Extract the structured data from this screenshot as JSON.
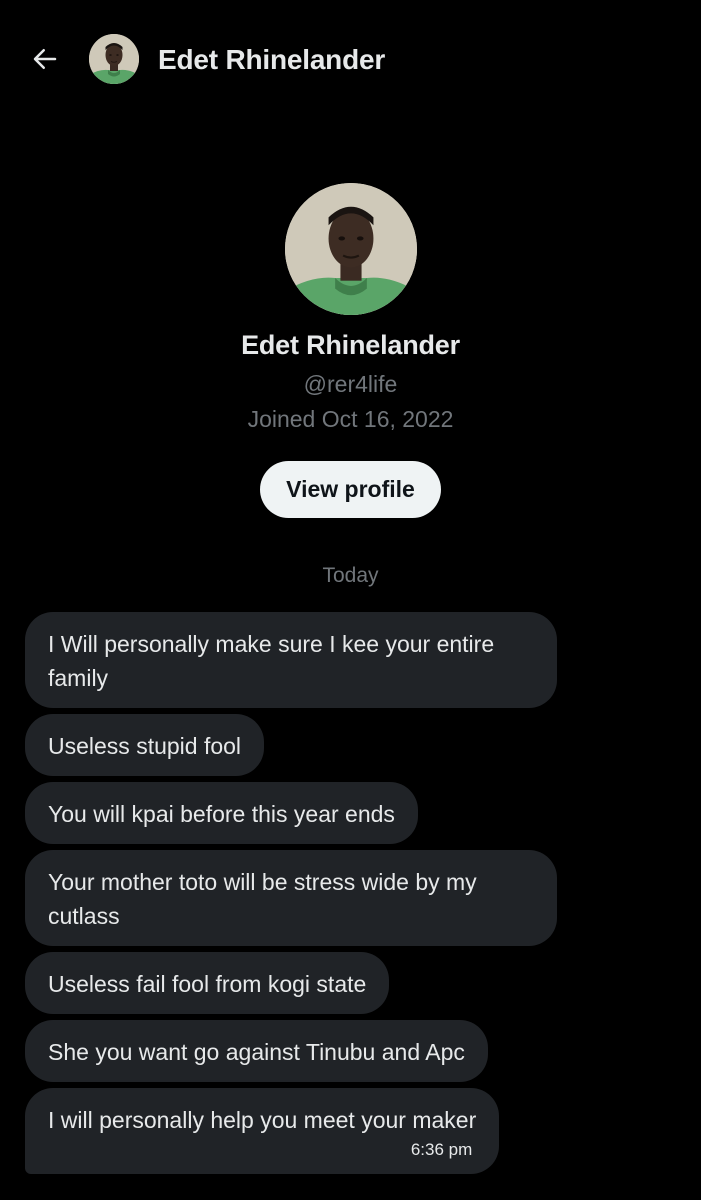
{
  "header": {
    "back_icon": "arrow-left-icon",
    "name": "Edet Rhinelander"
  },
  "profile": {
    "name": "Edet Rhinelander",
    "handle": "@rer4life",
    "joined": "Joined Oct 16, 2022",
    "view_profile_label": "View profile"
  },
  "conversation": {
    "day_label": "Today",
    "messages": [
      {
        "text": "I Will personally make sure I kee your entire family"
      },
      {
        "text": "Useless stupid fool"
      },
      {
        "text": "You will kpai before this year ends"
      },
      {
        "text": "Your mother toto will be stress wide by my cutlass"
      },
      {
        "text": "Useless fail fool from kogi state"
      },
      {
        "text": "She you want go against Tinubu and Apc"
      },
      {
        "text": "I will personally help you meet your maker",
        "time": "6:36 pm"
      }
    ]
  },
  "colors": {
    "background": "#000000",
    "bubble": "#202327",
    "primary_text": "#e7e9ea",
    "secondary_text": "#71767b",
    "button_bg": "#eff3f4"
  }
}
